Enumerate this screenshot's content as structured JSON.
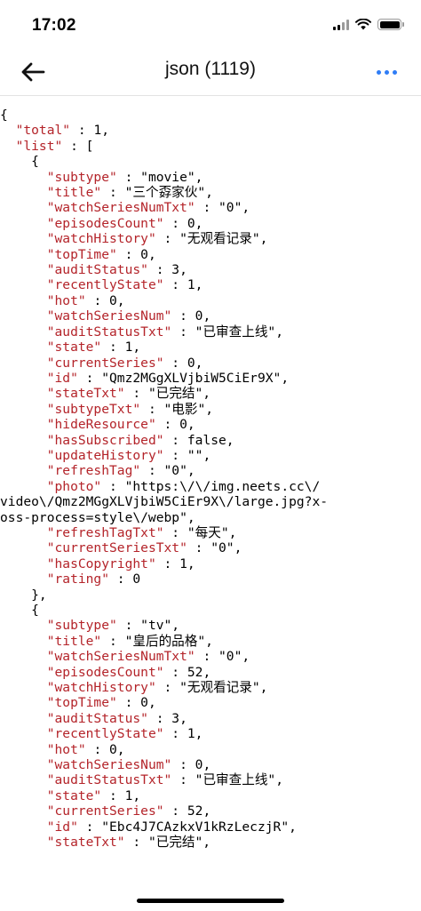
{
  "status_bar": {
    "time": "17:02"
  },
  "nav": {
    "title": "json (1119)"
  },
  "json_lines": [
    {
      "pre": "{",
      "key": "",
      "post": ""
    },
    {
      "pre": "  ",
      "key": "\"total\"",
      "post": " : 1,"
    },
    {
      "pre": "  ",
      "key": "\"list\"",
      "post": " : ["
    },
    {
      "pre": "    {",
      "key": "",
      "post": ""
    },
    {
      "pre": "      ",
      "key": "\"subtype\"",
      "post": " : \"movie\","
    },
    {
      "pre": "      ",
      "key": "\"title\"",
      "post": " : \"三个孬家伙\","
    },
    {
      "pre": "      ",
      "key": "\"watchSeriesNumTxt\"",
      "post": " : \"0\","
    },
    {
      "pre": "      ",
      "key": "\"episodesCount\"",
      "post": " : 0,"
    },
    {
      "pre": "      ",
      "key": "\"watchHistory\"",
      "post": " : \"无观看记录\","
    },
    {
      "pre": "      ",
      "key": "\"topTime\"",
      "post": " : 0,"
    },
    {
      "pre": "      ",
      "key": "\"auditStatus\"",
      "post": " : 3,"
    },
    {
      "pre": "      ",
      "key": "\"recentlyState\"",
      "post": " : 1,"
    },
    {
      "pre": "      ",
      "key": "\"hot\"",
      "post": " : 0,"
    },
    {
      "pre": "      ",
      "key": "\"watchSeriesNum\"",
      "post": " : 0,"
    },
    {
      "pre": "      ",
      "key": "\"auditStatusTxt\"",
      "post": " : \"已审查上线\","
    },
    {
      "pre": "      ",
      "key": "\"state\"",
      "post": " : 1,"
    },
    {
      "pre": "      ",
      "key": "\"currentSeries\"",
      "post": " : 0,"
    },
    {
      "pre": "      ",
      "key": "\"id\"",
      "post": " : \"Qmz2MGgXLVjbiW5CiEr9X\","
    },
    {
      "pre": "      ",
      "key": "\"stateTxt\"",
      "post": " : \"已完结\","
    },
    {
      "pre": "      ",
      "key": "\"subtypeTxt\"",
      "post": " : \"电影\","
    },
    {
      "pre": "      ",
      "key": "\"hideResource\"",
      "post": " : 0,"
    },
    {
      "pre": "      ",
      "key": "\"hasSubscribed\"",
      "post": " : false,"
    },
    {
      "pre": "      ",
      "key": "\"updateHistory\"",
      "post": " : \"\","
    },
    {
      "pre": "      ",
      "key": "\"refreshTag\"",
      "post": " : \"0\","
    },
    {
      "pre": "      ",
      "key": "\"photo\"",
      "post": " : \"https:\\/\\/img.neets.cc\\/"
    },
    {
      "pre": "video\\/Qmz2MGgXLVjbiW5CiEr9X\\/large.jpg?x-",
      "key": "",
      "post": ""
    },
    {
      "pre": "oss-process=style\\/webp\",",
      "key": "",
      "post": ""
    },
    {
      "pre": "      ",
      "key": "\"refreshTagTxt\"",
      "post": " : \"每天\","
    },
    {
      "pre": "      ",
      "key": "\"currentSeriesTxt\"",
      "post": " : \"0\","
    },
    {
      "pre": "      ",
      "key": "\"hasCopyright\"",
      "post": " : 1,"
    },
    {
      "pre": "      ",
      "key": "\"rating\"",
      "post": " : 0"
    },
    {
      "pre": "    },",
      "key": "",
      "post": ""
    },
    {
      "pre": "    {",
      "key": "",
      "post": ""
    },
    {
      "pre": "      ",
      "key": "\"subtype\"",
      "post": " : \"tv\","
    },
    {
      "pre": "      ",
      "key": "\"title\"",
      "post": " : \"皇后的品格\","
    },
    {
      "pre": "      ",
      "key": "\"watchSeriesNumTxt\"",
      "post": " : \"0\","
    },
    {
      "pre": "      ",
      "key": "\"episodesCount\"",
      "post": " : 52,"
    },
    {
      "pre": "      ",
      "key": "\"watchHistory\"",
      "post": " : \"无观看记录\","
    },
    {
      "pre": "      ",
      "key": "\"topTime\"",
      "post": " : 0,"
    },
    {
      "pre": "      ",
      "key": "\"auditStatus\"",
      "post": " : 3,"
    },
    {
      "pre": "      ",
      "key": "\"recentlyState\"",
      "post": " : 1,"
    },
    {
      "pre": "      ",
      "key": "\"hot\"",
      "post": " : 0,"
    },
    {
      "pre": "      ",
      "key": "\"watchSeriesNum\"",
      "post": " : 0,"
    },
    {
      "pre": "      ",
      "key": "\"auditStatusTxt\"",
      "post": " : \"已审查上线\","
    },
    {
      "pre": "      ",
      "key": "\"state\"",
      "post": " : 1,"
    },
    {
      "pre": "      ",
      "key": "\"currentSeries\"",
      "post": " : 52,"
    },
    {
      "pre": "      ",
      "key": "\"id\"",
      "post": " : \"Ebc4J7CAzkxV1kRzLeczjR\","
    },
    {
      "pre": "      ",
      "key": "\"stateTxt\"",
      "post": " : \"已完结\","
    }
  ]
}
